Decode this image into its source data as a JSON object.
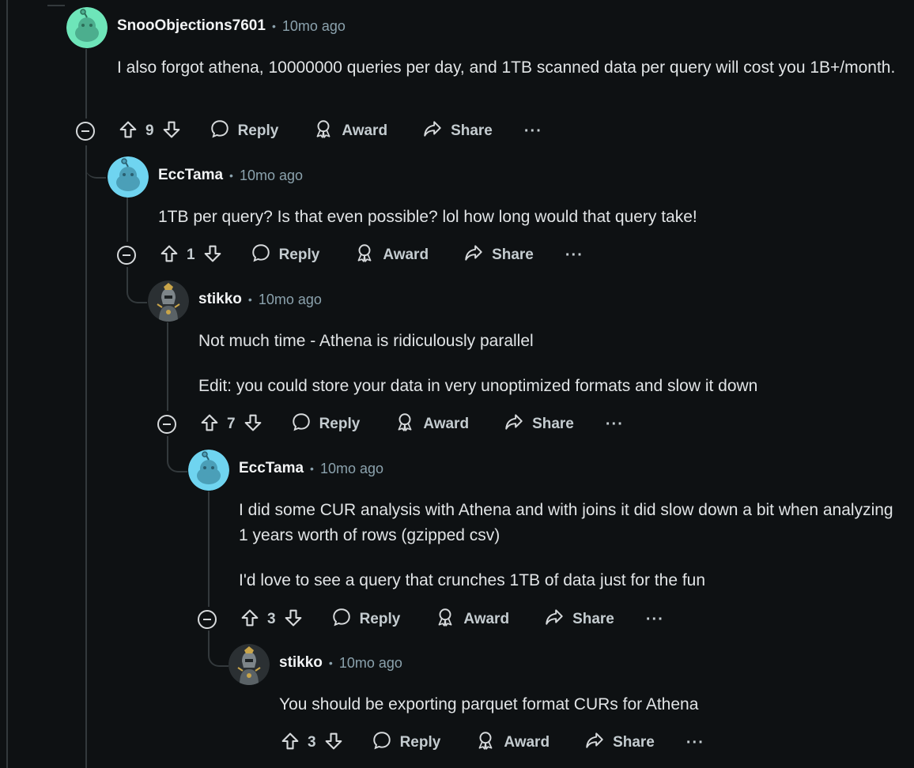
{
  "comments": [
    {
      "author": "SnooObjections7601",
      "time": "10mo ago",
      "avatar": "snoo-green",
      "body": [
        "I also forgot athena, 10000000 queries per day, and 1TB scanned data per query will cost you 1B+/month."
      ],
      "votes": "9"
    },
    {
      "author": "EccTama",
      "time": "10mo ago",
      "avatar": "snoo-blue",
      "body": [
        "1TB per query? Is that even possible? lol how long would that query take!"
      ],
      "votes": "1"
    },
    {
      "author": "stikko",
      "time": "10mo ago",
      "avatar": "robot-figure",
      "body": [
        "Not much time - Athena is ridiculously parallel",
        "Edit: you could store your data in very unoptimized formats and slow it down"
      ],
      "votes": "7"
    },
    {
      "author": "EccTama",
      "time": "10mo ago",
      "avatar": "snoo-blue",
      "body": [
        "I did some CUR analysis with Athena and with joins it did slow down a bit when analyzing 1 years worth of rows (gzipped csv)",
        "I'd love to see a query that crunches 1TB of data just for the fun"
      ],
      "votes": "3"
    },
    {
      "author": "stikko",
      "time": "10mo ago",
      "avatar": "robot-figure",
      "body": [
        "You should be exporting parquet format CURs for Athena"
      ],
      "votes": "3"
    }
  ],
  "labels": {
    "dot": "•",
    "reply": "Reply",
    "award": "Award",
    "share": "Share",
    "more": "···"
  },
  "colors": {
    "background": "#0e1113",
    "thread_line": "#33393c",
    "snoo_green": "#6ee5b9",
    "snoo_blue": "#6fd4f0"
  }
}
